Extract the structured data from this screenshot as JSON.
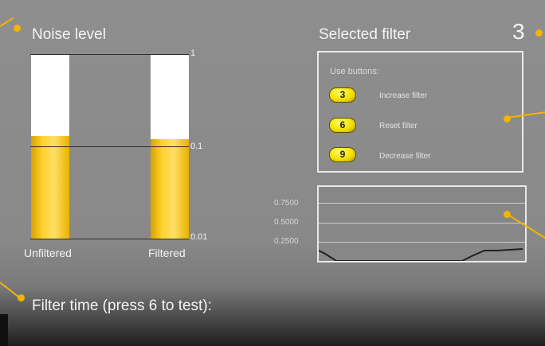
{
  "noise_panel": {
    "title": "Noise level",
    "chart_data": {
      "type": "bar",
      "categories": [
        "Unfiltered",
        "Filtered"
      ],
      "values": [
        0.13,
        0.12
      ],
      "yscale": "log",
      "ylim": [
        0.01,
        1
      ],
      "yticks": [
        "1",
        "0.1",
        "0.01"
      ]
    }
  },
  "filter_panel": {
    "title": "Selected filter",
    "value": "3",
    "instructions_label": "Use buttons:",
    "buttons": [
      {
        "key": "3",
        "label": "Increase filter"
      },
      {
        "key": "6",
        "label": "Reset filter"
      },
      {
        "key": "9",
        "label": "Decrease filter"
      }
    ]
  },
  "response_graph": {
    "y_labels": [
      "0.7500",
      "0.5000",
      "0.2500"
    ]
  },
  "filter_time": {
    "label": "Filter time (press 6 to test):"
  },
  "colors": {
    "accent": "#f2b400",
    "bar": "#ffd22e",
    "background": "#8a8a8a"
  }
}
